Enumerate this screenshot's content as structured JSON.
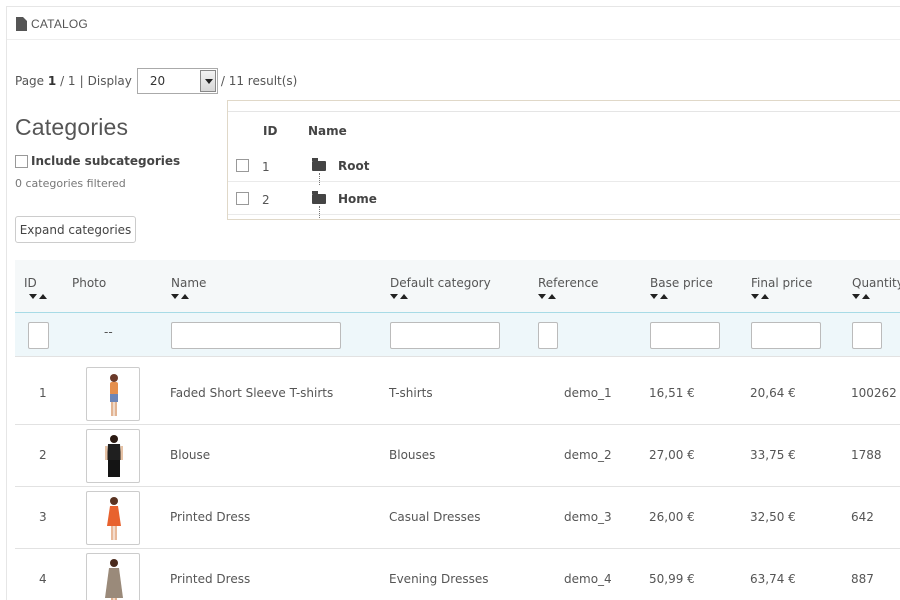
{
  "panel": {
    "title": "CATALOG"
  },
  "pager": {
    "page_label": "Page",
    "current_page": "1",
    "total_pages": "/ 1",
    "sep": "|",
    "display_label": "Display",
    "display_value": "20",
    "results": "/ 11 result(s)"
  },
  "categories": {
    "title": "Categories",
    "include_sub": "Include subcategories",
    "filtered": "0 categories filtered",
    "expand_btn": "Expand categories"
  },
  "tree": {
    "head_id": "ID",
    "head_name": "Name",
    "rows": [
      {
        "id": "1",
        "name": "Root"
      },
      {
        "id": "2",
        "name": "Home"
      }
    ]
  },
  "grid": {
    "headers": [
      "ID",
      "Photo",
      "Name",
      "Default category",
      "Reference",
      "Base price",
      "Final price",
      "Quantity"
    ],
    "photo_filter": "--",
    "rows": [
      {
        "id": "1",
        "name": "Faded Short Sleeve T-shirts",
        "category": "T-shirts",
        "reference": "demo_1",
        "base": "16,51 €",
        "final": "20,64 €",
        "qty": "100262",
        "dress_color": "#e58f4d"
      },
      {
        "id": "2",
        "name": "Blouse",
        "category": "Blouses",
        "reference": "demo_2",
        "base": "27,00 €",
        "final": "33,75 €",
        "qty": "1788",
        "dress_color": "#1f1f1f"
      },
      {
        "id": "3",
        "name": "Printed Dress",
        "category": "Casual Dresses",
        "reference": "demo_3",
        "base": "26,00 €",
        "final": "32,50 €",
        "qty": "642",
        "dress_color": "#e8622e"
      },
      {
        "id": "4",
        "name": "Printed Dress",
        "category": "Evening Dresses",
        "reference": "demo_4",
        "base": "50,99 €",
        "final": "63,74 €",
        "qty": "887",
        "dress_color": "#9a8a7a"
      }
    ]
  }
}
